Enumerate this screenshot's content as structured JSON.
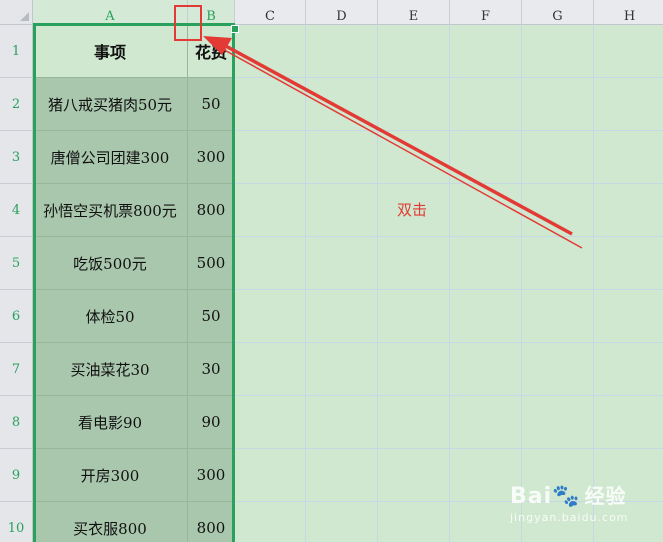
{
  "columns": [
    "A",
    "B",
    "C",
    "D",
    "E",
    "F",
    "G",
    "H"
  ],
  "rows": [
    {
      "num": "1",
      "a": "事项",
      "b": "花费"
    },
    {
      "num": "2",
      "a": "猪八戒买猪肉50元",
      "b": "50"
    },
    {
      "num": "3",
      "a": "唐僧公司团建300",
      "b": "300"
    },
    {
      "num": "4",
      "a": "孙悟空买机票800元",
      "b": "800"
    },
    {
      "num": "5",
      "a": "吃饭500元",
      "b": "500"
    },
    {
      "num": "6",
      "a": "体检50",
      "b": "50"
    },
    {
      "num": "7",
      "a": "买油菜花30",
      "b": "30"
    },
    {
      "num": "8",
      "a": "看电影90",
      "b": "90"
    },
    {
      "num": "9",
      "a": "开房300",
      "b": "300"
    },
    {
      "num": "10",
      "a": "买衣服800",
      "b": "800"
    }
  ],
  "annotation": {
    "label": "双击",
    "color": "#e33a35"
  },
  "watermark": {
    "brand": "Bai",
    "brand_zh": "经验",
    "domain": "jingyan.baidu.com"
  },
  "colors": {
    "selection": "#27a15b",
    "sheet_bg": "#cfe8cf",
    "selected_cell_bg": "#a9c7ad"
  }
}
